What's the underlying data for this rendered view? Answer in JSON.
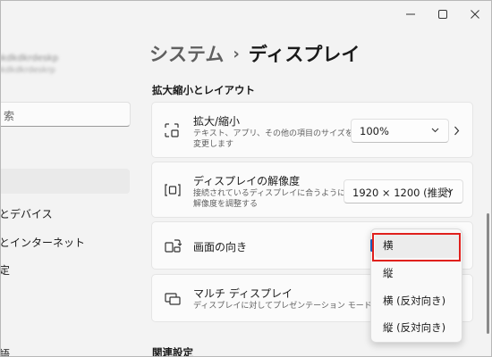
{
  "window": {
    "controls": {
      "minimize": "minimize-icon",
      "maximize": "maximize-icon",
      "close": "close-icon"
    }
  },
  "sidebar": {
    "profile_name": "hkdkdkrdeskp",
    "profile_email": "hkdkdkrdeskrp",
    "search_placeholder": "索",
    "items": [
      {
        "label": "とデバイス"
      },
      {
        "label": "とインターネット"
      },
      {
        "label": "定"
      },
      {
        "label": "語"
      }
    ]
  },
  "breadcrumb": {
    "parent": "システム",
    "separator": "›",
    "current": "ディスプレイ"
  },
  "sections": {
    "scale_layout": "拡大縮小とレイアウト",
    "related": "関連設定"
  },
  "cards": {
    "scale": {
      "title": "拡大/縮小",
      "desc_line1": "テキスト、アプリ、その他の項目のサイズを",
      "desc_line2": "変更します",
      "value": "100%",
      "icon": "scale-icon"
    },
    "resolution": {
      "title": "ディスプレイの解像度",
      "desc_line1": "接続されているディスプレイに合うように",
      "desc_line2": "解像度を調整する",
      "value": "1920 × 1200 (推奨)",
      "icon": "resolution-icon"
    },
    "orientation": {
      "title": "画面の向き",
      "icon": "orientation-icon"
    },
    "multi": {
      "title": "マルチ ディスプレイ",
      "desc_line1": "ディスプレイに対してプレゼンテーション モードを選択",
      "icon": "multi-display-icon"
    }
  },
  "orientation_menu": {
    "options": [
      "横",
      "縦",
      "横 (反対向き)",
      "縦 (反対向き)"
    ],
    "selected": "横",
    "highlight_color": "#e0201c",
    "accent_color": "#1b5fb8"
  }
}
